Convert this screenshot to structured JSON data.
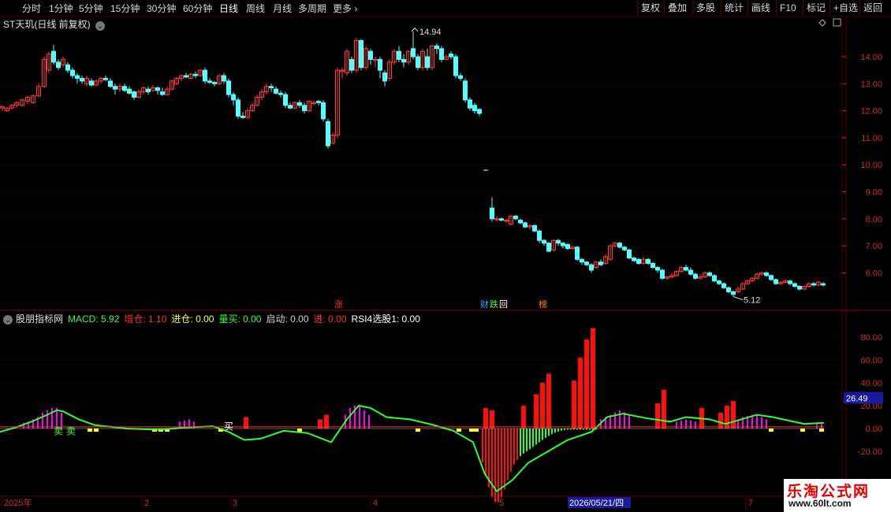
{
  "toolbar": {
    "periods": [
      "分时",
      "1分钟",
      "5分钟",
      "15分钟",
      "30分钟",
      "60分钟",
      "日线",
      "周线",
      "月线",
      "多周期"
    ],
    "active_period": "日线",
    "more_label": "更多",
    "right_buttons": [
      "复权",
      "叠加",
      "多股",
      "统计",
      "画线",
      "F10",
      "标记",
      "+自选",
      "返回"
    ]
  },
  "main_panel": {
    "title": "ST天玑(日线 前复权)",
    "high_label": "14.94",
    "low_label": "5.12",
    "y_ticks": [
      "14.00",
      "13.00",
      "12.00",
      "11.00",
      "10.00",
      "9.00",
      "8.00",
      "7.00",
      "6.00"
    ],
    "markers": [
      {
        "text": "涨",
        "color": "#ff3030"
      },
      {
        "text": "财",
        "color": "#40a0ff"
      },
      {
        "text": "跌",
        "color": "#40ff40"
      },
      {
        "text": "回",
        "color": "#ffffff"
      },
      {
        "text": "榜",
        "color": "#ff8c00"
      }
    ]
  },
  "indicator_panel": {
    "name": "股朋指标网",
    "fields": [
      {
        "label": "MACD: 5.92",
        "color": "#40ff40"
      },
      {
        "label": "增仓: 1.10",
        "color": "#ff3030"
      },
      {
        "label": "进仓: 0.00",
        "color": "#ffff40"
      },
      {
        "label": "量买: 0.00",
        "color": "#40ff40"
      },
      {
        "label": "启动: 0.00",
        "color": "#d0d0d0"
      },
      {
        "label": "进: 0.00",
        "color": "#ff3030"
      },
      {
        "label": "RSI4选股1: 0.00",
        "color": "#ffffff"
      }
    ],
    "y_ticks": [
      "80.00",
      "60.00",
      "40.00",
      "20.00",
      "0.00",
      "-20.00"
    ],
    "current_value": "26.49",
    "sell_labels": [
      "卖",
      "卖"
    ],
    "buy_label": "买"
  },
  "date_axis": {
    "labels": [
      "2025年",
      "2",
      "3",
      "4",
      "5",
      "7"
    ],
    "cursor_date": "2026/05/21/四"
  },
  "watermark": {
    "line1": "乐淘公式网",
    "line2": "www.60lt.com"
  },
  "colors": {
    "up": "#ff3b3b",
    "down": "#54ffff",
    "grid": "#5a0000",
    "axis": "#c83232",
    "macd_line": "#30ff30",
    "dif_line": "#ff3030",
    "hist_pos": "#ff00ff",
    "hist_neg": "#30ff30",
    "bar_red": "#ff1010"
  }
}
